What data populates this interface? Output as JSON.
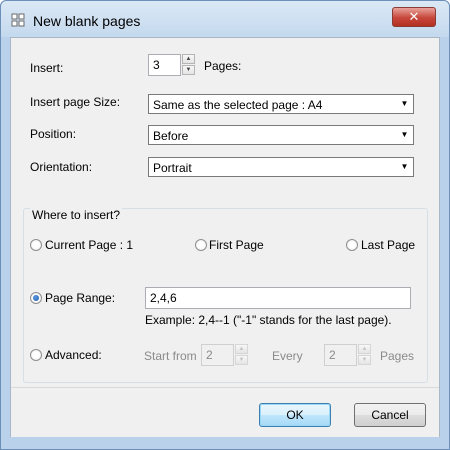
{
  "window": {
    "title": "New blank pages",
    "close_glyph": "✕"
  },
  "insert": {
    "label": "Insert:",
    "value": "3",
    "suffix": "Pages:"
  },
  "page_size": {
    "label": "Insert page Size:",
    "value": "Same as the selected page : A4"
  },
  "position": {
    "label": "Position:",
    "value": "Before"
  },
  "orientation": {
    "label": "Orientation:",
    "value": "Portrait"
  },
  "where": {
    "title": "Where to insert?",
    "current_page": "Current Page : 1",
    "first_page": "First Page",
    "last_page": "Last Page",
    "page_range": "Page Range:",
    "page_range_value": "2,4,6",
    "example": "Example: 2,4--1 (\"-1\" stands for the last page).",
    "advanced": "Advanced:",
    "start_from_label": "Start from",
    "start_from_value": "2",
    "every_label": "Every",
    "every_value": "2",
    "pages_label": "Pages",
    "selected": "page_range"
  },
  "buttons": {
    "ok": "OK",
    "cancel": "Cancel"
  },
  "icons": {
    "app": "new-pages-icon",
    "spin_up": "▲",
    "spin_down": "▼",
    "dropdown": "▼"
  }
}
